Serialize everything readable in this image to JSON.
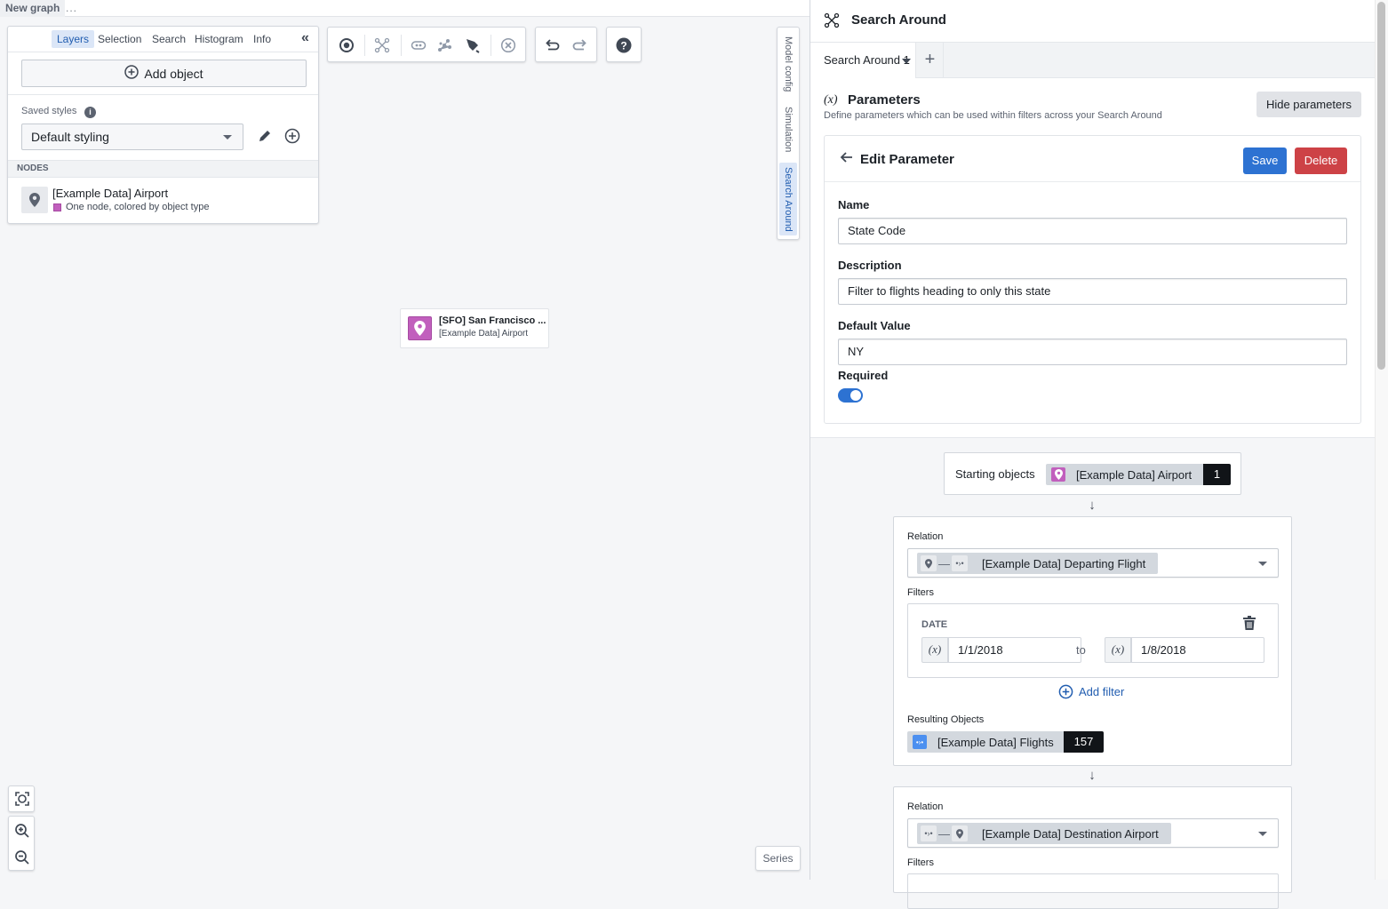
{
  "top_bar": {
    "graph_tab": "New graph",
    "more_label": "..."
  },
  "left_panel": {
    "tabs": [
      {
        "label": "Layers",
        "active": true
      },
      {
        "label": "Selection",
        "active": false
      },
      {
        "label": "Search",
        "active": false
      },
      {
        "label": "Histogram",
        "active": false
      },
      {
        "label": "Info",
        "active": false
      }
    ],
    "collapse_icon": "double-chevron-left",
    "add_object_label": "Add object",
    "saved_styles_label": "Saved styles",
    "saved_styles_value": "Default styling",
    "nodes_header": "NODES",
    "node": {
      "title": "[Example Data] Airport",
      "subtitle": "One node, colored by object type",
      "color": "#c15fbd"
    }
  },
  "toolbar": {
    "groups": [
      [
        "select-target",
        "layout-graph",
        "link",
        "scatter-nodes",
        "pen-draw",
        "remove"
      ],
      [
        "undo",
        "redo"
      ],
      [
        "help"
      ]
    ]
  },
  "canvas": {
    "node": {
      "title": "[SFO] San Francisco ...",
      "subtitle": "[Example Data] Airport",
      "color": "#c15fbd"
    }
  },
  "side_tabs": [
    {
      "label": "Model config",
      "active": false
    },
    {
      "label": "Simulation",
      "active": false
    },
    {
      "label": "Search Around",
      "active": true
    }
  ],
  "zoom_controls": [
    "fit-to-screen",
    "zoom-in",
    "zoom-out"
  ],
  "series_label": "Series",
  "right_panel": {
    "title": "Search Around",
    "tabs": [
      {
        "label": "Search Around 1",
        "active": true
      }
    ],
    "add_tab_label": "+",
    "parameters": {
      "icon_label": "(x)",
      "title": "Parameters",
      "description": "Define parameters which can be used within filters across your Search Around",
      "hide_button": "Hide parameters"
    },
    "edit_parameter": {
      "title": "Edit Parameter",
      "save_label": "Save",
      "delete_label": "Delete",
      "name_label": "Name",
      "name_value": "State Code",
      "description_label": "Description",
      "description_value": "Filter to flights heading to only this state",
      "default_label": "Default Value",
      "default_value": "NY",
      "required_label": "Required",
      "required": true
    },
    "flow": {
      "starting_label": "Starting objects",
      "starting_object": "[Example Data] Airport",
      "starting_count": "1",
      "steps": [
        {
          "relation_label": "Relation",
          "relation_value": "[Example Data] Departing Flight",
          "filters_label": "Filters",
          "filter": {
            "property": "DATE",
            "param_icon": "(x)",
            "from": "1/1/2018",
            "to_label": "to",
            "to": "1/8/2018"
          },
          "add_filter_label": "Add filter",
          "result_label": "Resulting Objects",
          "result_object": "[Example Data] Flights",
          "result_count": "157"
        },
        {
          "relation_label": "Relation",
          "relation_value": "[Example Data] Destination Airport",
          "filters_label": "Filters"
        }
      ]
    }
  },
  "colors": {
    "accent": "#2d72d2",
    "danger": "#cd4246",
    "airport": "#c15fbd",
    "flight": "#4c90f0"
  }
}
